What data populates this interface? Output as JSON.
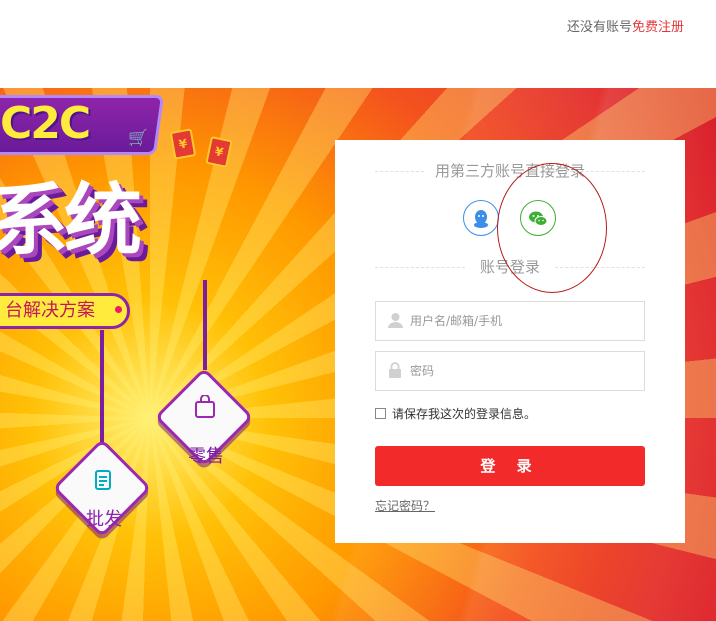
{
  "header": {
    "no_account_text": "还没有账号",
    "register_link": "免费注册"
  },
  "banner": {
    "badge_text": "C2C",
    "title_text": "系统",
    "subtitle_text": "台解决方案",
    "retail_label": "零售",
    "wholesale_label": "批发",
    "redpack_symbol": "¥"
  },
  "login": {
    "third_party_title": "用第三方账号直接登录",
    "account_title": "账号登录",
    "username_placeholder": "用户名/邮箱/手机",
    "password_placeholder": "密码",
    "remember_label": "请保存我这次的登录信息。",
    "login_button": "登 录",
    "forgot_link": "忘记密码？"
  },
  "colors": {
    "accent_red": "#f32a2a",
    "qq_blue": "#3d8ee8",
    "wechat_green": "#3cb034"
  },
  "icons": {
    "qq": "qq-icon",
    "wechat": "wechat-icon",
    "user": "user-icon",
    "lock": "lock-icon"
  }
}
